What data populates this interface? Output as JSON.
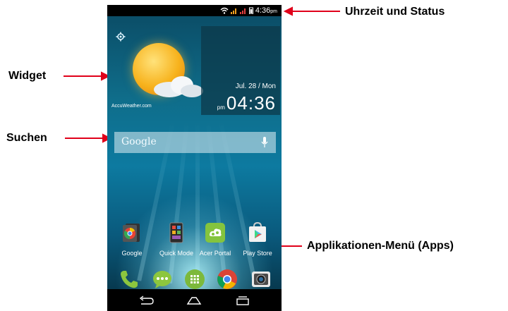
{
  "status_bar": {
    "time": "4:36",
    "time_suffix": "pm"
  },
  "widget": {
    "weather_credit": "AccuWeather.com",
    "date": "Jul. 28 / Mon",
    "clock_prefix": "pm",
    "clock_time": "04:36"
  },
  "search": {
    "logo_text": "Google"
  },
  "apps": [
    {
      "label": "Google"
    },
    {
      "label": "Quick Mode"
    },
    {
      "label": "Acer Portal"
    },
    {
      "label": "Play Store"
    }
  ],
  "callouts": {
    "status": "Uhrzeit und Status",
    "widget": "Widget",
    "search": "Suchen",
    "apps": "Applikationen-Menü (Apps)"
  },
  "colors": {
    "arrow": "#e0001a",
    "apps_button": "#7cb93b",
    "acer_portal": "#84c43e"
  },
  "icons": [
    "wifi-icon",
    "signal-icon",
    "battery-icon",
    "gear-icon",
    "sun-icon",
    "cloud-icon",
    "mic-icon",
    "phone-icon",
    "messages-icon",
    "apps-grid-icon",
    "chrome-icon",
    "camera-icon",
    "back-icon",
    "home-icon",
    "recents-icon"
  ]
}
